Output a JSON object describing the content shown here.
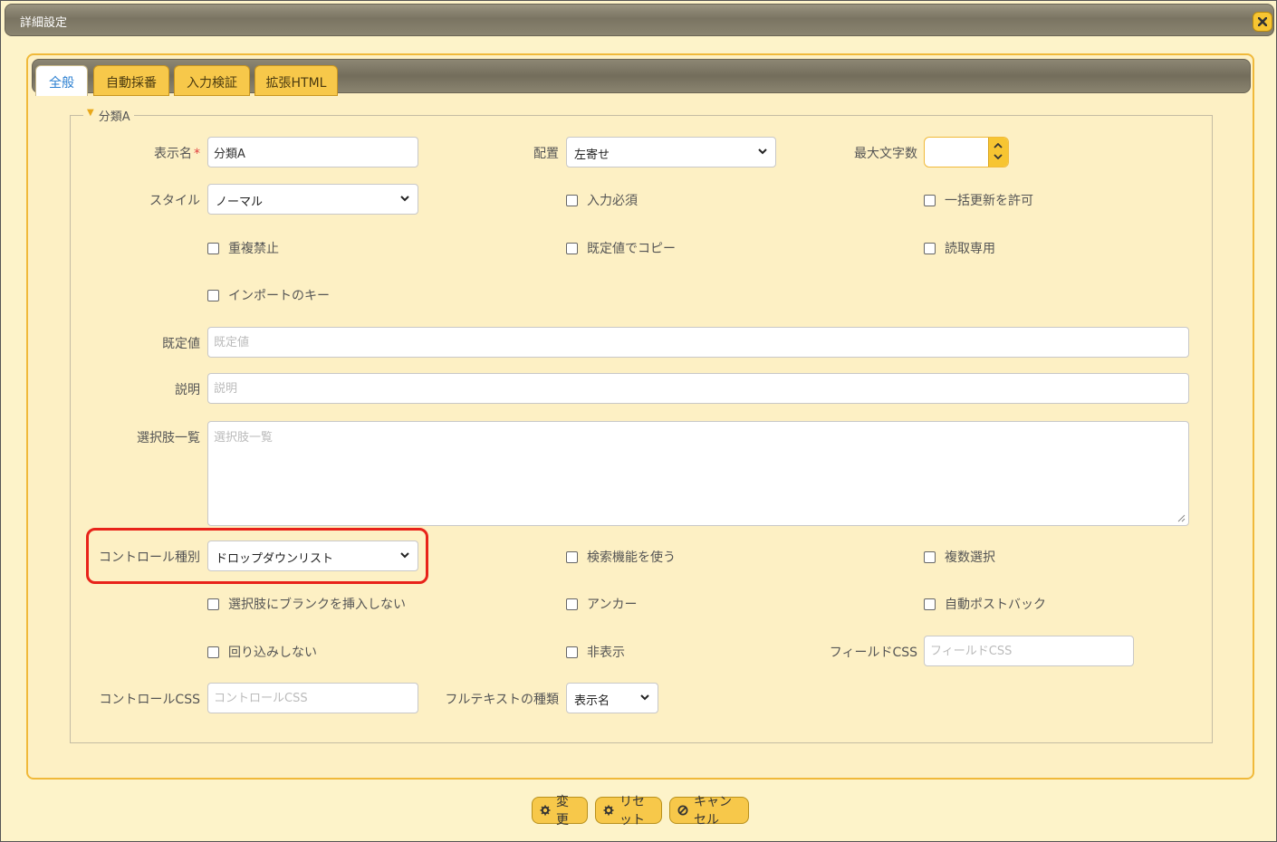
{
  "dialog": {
    "title": "詳細設定"
  },
  "tabs": [
    {
      "label": "全般",
      "active": true
    },
    {
      "label": "自動採番",
      "active": false
    },
    {
      "label": "入力検証",
      "active": false
    },
    {
      "label": "拡張HTML",
      "active": false
    }
  ],
  "section": {
    "legend": "分類A"
  },
  "fields": {
    "display_name": {
      "label": "表示名",
      "required_mark": "*",
      "value": "分類A"
    },
    "alignment": {
      "label": "配置",
      "value": "左寄せ"
    },
    "max_length": {
      "label": "最大文字数",
      "value": ""
    },
    "style": {
      "label": "スタイル",
      "value": "ノーマル"
    },
    "default_value": {
      "label": "既定値",
      "placeholder": "既定値"
    },
    "description": {
      "label": "説明",
      "placeholder": "説明"
    },
    "choices": {
      "label": "選択肢一覧",
      "placeholder": "選択肢一覧"
    },
    "control_type": {
      "label": "コントロール種別",
      "value": "ドロップダウンリスト"
    },
    "field_css": {
      "label": "フィールドCSS",
      "placeholder": "フィールドCSS"
    },
    "control_css": {
      "label": "コントロールCSS",
      "placeholder": "コントロールCSS"
    },
    "fulltext_type": {
      "label": "フルテキストの種類",
      "value": "表示名"
    }
  },
  "checkboxes": {
    "required": "入力必須",
    "bulk_update": "一括更新を許可",
    "no_duplicates": "重複禁止",
    "copy_by_default": "既定値でコピー",
    "read_only": "読取専用",
    "import_key": "インポートのキー",
    "use_search": "検索機能を使う",
    "multiple_select": "複数選択",
    "no_blank_choice": "選択肢にブランクを挿入しない",
    "anchor": "アンカー",
    "auto_postback": "自動ポストバック",
    "no_wrap": "回り込みしない",
    "hidden": "非表示"
  },
  "buttons": {
    "change": "変更",
    "reset": "リセット",
    "cancel": "キャンセル"
  },
  "colors": {
    "accent": "#f7c532",
    "highlight": "#e8231a",
    "active_tab_text": "#2a7fd0"
  }
}
